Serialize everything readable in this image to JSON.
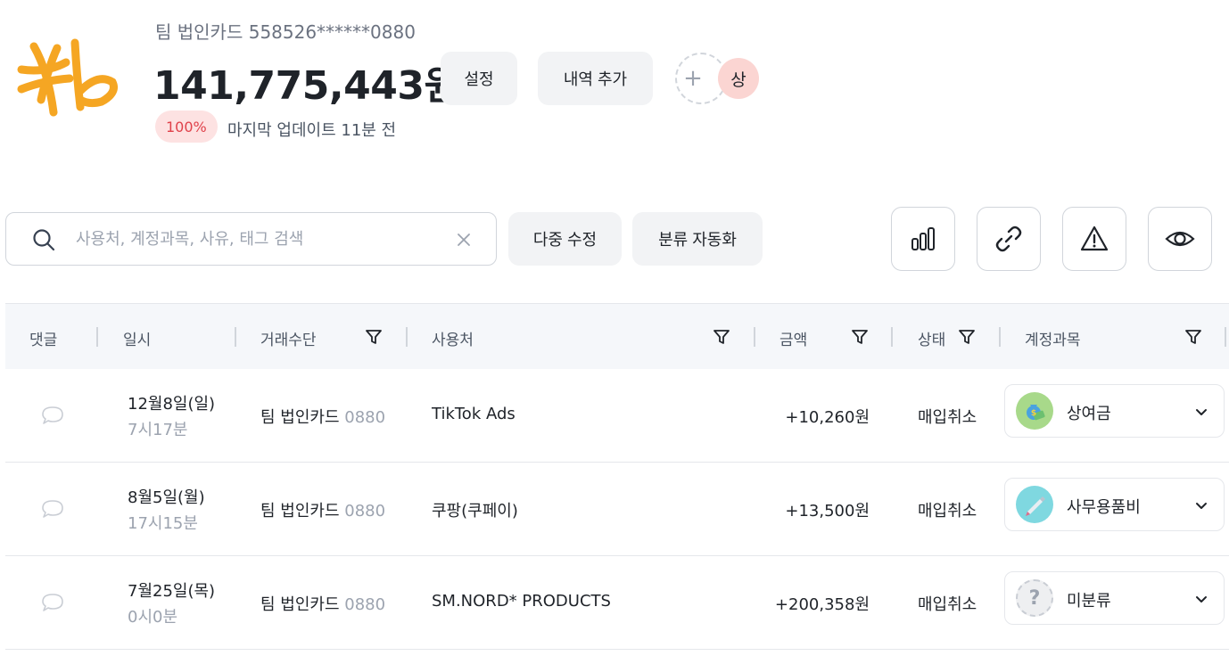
{
  "header": {
    "logo_label": "Kb",
    "card_name": "팀 법인카드 558526******0880",
    "balance": "141,775,443원",
    "settings_label": "설정",
    "add_entry_label": "내역 추가",
    "add_member_symbol": "+",
    "member_avatar_text": "상",
    "percent_badge": "100%",
    "last_update": "마지막 업데이트 11분 전"
  },
  "toolbar": {
    "search_placeholder": "사용처, 계정과목, 사유, 태그 검색",
    "search_value": "",
    "multi_edit_label": "다중 수정",
    "auto_classify_label": "분류 자동화",
    "icon_buttons": [
      "bar-chart-icon",
      "link-icon",
      "warning-icon",
      "eye-icon"
    ]
  },
  "table": {
    "columns": {
      "comment": "댓글",
      "datetime": "일시",
      "method": "거래수단",
      "merchant": "사용처",
      "amount": "금액",
      "status": "상태",
      "account": "계정과목"
    },
    "rows": [
      {
        "date": "12월8일(일)",
        "time": "7시17분",
        "method_name": "팀 법인카드",
        "method_num": "0880",
        "merchant": "TikTok Ads",
        "amount": "+10,260원",
        "status": "매입취소",
        "account": "상여금",
        "account_icon": "money-bag-icon",
        "account_icon_bg": "#a8d98a"
      },
      {
        "date": "8월5일(월)",
        "time": "17시15분",
        "method_name": "팀 법인카드",
        "method_num": "0880",
        "merchant": "쿠팡(쿠페이)",
        "amount": "+13,500원",
        "status": "매입취소",
        "account": "사무용품비",
        "account_icon": "pen-icon",
        "account_icon_bg": "#7fd8e0"
      },
      {
        "date": "7월25일(목)",
        "time": "0시0분",
        "method_name": "팀 법인카드",
        "method_num": "0880",
        "merchant": "SM.NORD* PRODUCTS",
        "amount": "+200,358원",
        "status": "매입취소",
        "account": "미분류",
        "account_icon": "question-icon",
        "account_icon_bg": "#eeeff1"
      }
    ]
  },
  "colors": {
    "logo": "#f5a623",
    "badge_bg": "#fde2e2",
    "badge_text": "#e0424b",
    "avatar_bg": "#fbd5d2",
    "button_bg": "#f2f3f5",
    "header_bg": "#f5f7fa"
  }
}
